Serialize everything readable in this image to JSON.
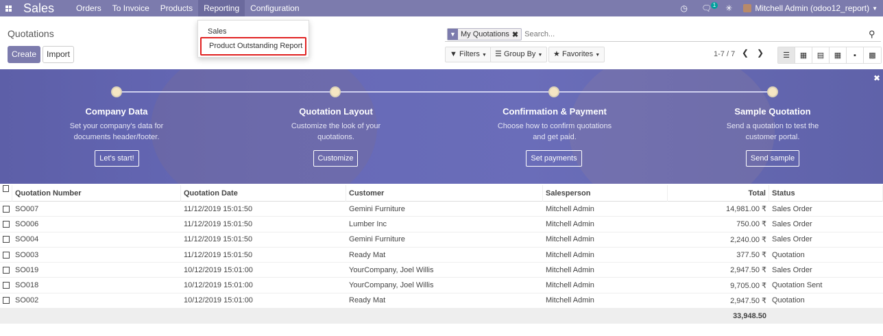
{
  "navbar": {
    "app_name": "Sales",
    "menu": [
      "Orders",
      "To Invoice",
      "Products",
      "Reporting",
      "Configuration"
    ],
    "chat_badge": "1",
    "user_name": "Mitchell Admin (odoo12_report)"
  },
  "dropdown": {
    "items": [
      "Sales",
      "Product Outstanding Report"
    ]
  },
  "control_panel": {
    "title": "Quotations",
    "create_label": "Create",
    "import_label": "Import",
    "facet_value": "My Quotations",
    "facet_close": "✖",
    "search_placeholder": "Search...",
    "filters_label": "Filters",
    "groupby_label": "Group By",
    "favorites_label": "Favorites",
    "pager": "1-7 / 7"
  },
  "banner": {
    "steps": [
      {
        "title": "Company Data",
        "desc": "Set your company's data for documents header/footer.",
        "button": "Let's start!"
      },
      {
        "title": "Quotation Layout",
        "desc": "Customize the look of your quotations.",
        "button": "Customize"
      },
      {
        "title": "Confirmation & Payment",
        "desc": "Choose how to confirm quotations and get paid.",
        "button": "Set payments"
      },
      {
        "title": "Sample Quotation",
        "desc": "Send a quotation to test the customer portal.",
        "button": "Send sample"
      }
    ]
  },
  "table": {
    "headers": {
      "number": "Quotation Number",
      "date": "Quotation Date",
      "customer": "Customer",
      "salesperson": "Salesperson",
      "total": "Total",
      "status": "Status"
    },
    "rows": [
      {
        "number": "SO007",
        "date": "11/12/2019 15:01:50",
        "customer": "Gemini Furniture",
        "salesperson": "Mitchell Admin",
        "total": "14,981.00 ₹",
        "status": "Sales Order"
      },
      {
        "number": "SO006",
        "date": "11/12/2019 15:01:50",
        "customer": "Lumber Inc",
        "salesperson": "Mitchell Admin",
        "total": "750.00 ₹",
        "status": "Sales Order"
      },
      {
        "number": "SO004",
        "date": "11/12/2019 15:01:50",
        "customer": "Gemini Furniture",
        "salesperson": "Mitchell Admin",
        "total": "2,240.00 ₹",
        "status": "Sales Order"
      },
      {
        "number": "SO003",
        "date": "11/12/2019 15:01:50",
        "customer": "Ready Mat",
        "salesperson": "Mitchell Admin",
        "total": "377.50 ₹",
        "status": "Quotation"
      },
      {
        "number": "SO019",
        "date": "10/12/2019 15:01:00",
        "customer": "YourCompany, Joel Willis",
        "salesperson": "Mitchell Admin",
        "total": "2,947.50 ₹",
        "status": "Sales Order"
      },
      {
        "number": "SO018",
        "date": "10/12/2019 15:01:00",
        "customer": "YourCompany, Joel Willis",
        "salesperson": "Mitchell Admin",
        "total": "9,705.00 ₹",
        "status": "Quotation Sent"
      },
      {
        "number": "SO002",
        "date": "10/12/2019 15:01:00",
        "customer": "Ready Mat",
        "salesperson": "Mitchell Admin",
        "total": "2,947.50 ₹",
        "status": "Quotation"
      }
    ],
    "footer_total": "33,948.50"
  },
  "colors": {
    "brand": "#7c7bad",
    "highlight_border": "#e02020",
    "badge": "#00a09d"
  }
}
